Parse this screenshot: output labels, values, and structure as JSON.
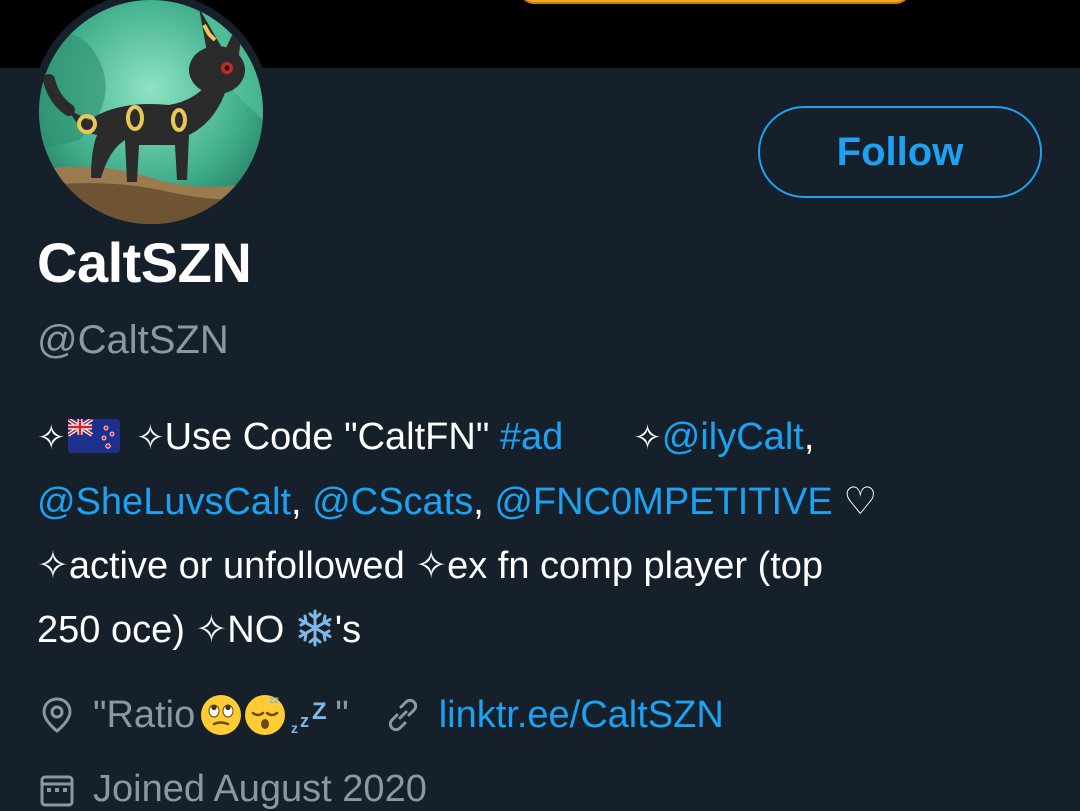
{
  "profile": {
    "display_name": "CaltSZN",
    "handle": "@CaltSZN",
    "follow_label": "Follow"
  },
  "bio": {
    "line1": {
      "spark1": "✧",
      "spark2": "✧",
      "text_code": "Use Code \"CaltFN\" ",
      "hashtag": "#ad",
      "spark3": "✧",
      "mention1": "@ilyCalt",
      "comma1": ","
    },
    "line2": {
      "mention2": "@SheLuvsCalt",
      "comma2": ", ",
      "mention3": "@CScats",
      "comma3": ", ",
      "mention4": "@FNC0MPETITIVE",
      "heart": " ♡"
    },
    "line3": "✧active or unfollowed ✧ex fn comp player (top",
    "line4_start": "250 oce) ✧NO ",
    "line4_end": "'s"
  },
  "meta": {
    "location_icon": "location-pin-icon",
    "location": "\"Ratio ",
    "location_end": "\"",
    "link_icon": "link-icon",
    "website": "linktr.ee/CaltSZN",
    "joined_icon": "calendar-icon",
    "joined": "Joined August 2020"
  },
  "colors": {
    "background": "#15202b",
    "accent": "#1da1f2",
    "secondary_text": "#8899a6",
    "banner": "#000000"
  }
}
